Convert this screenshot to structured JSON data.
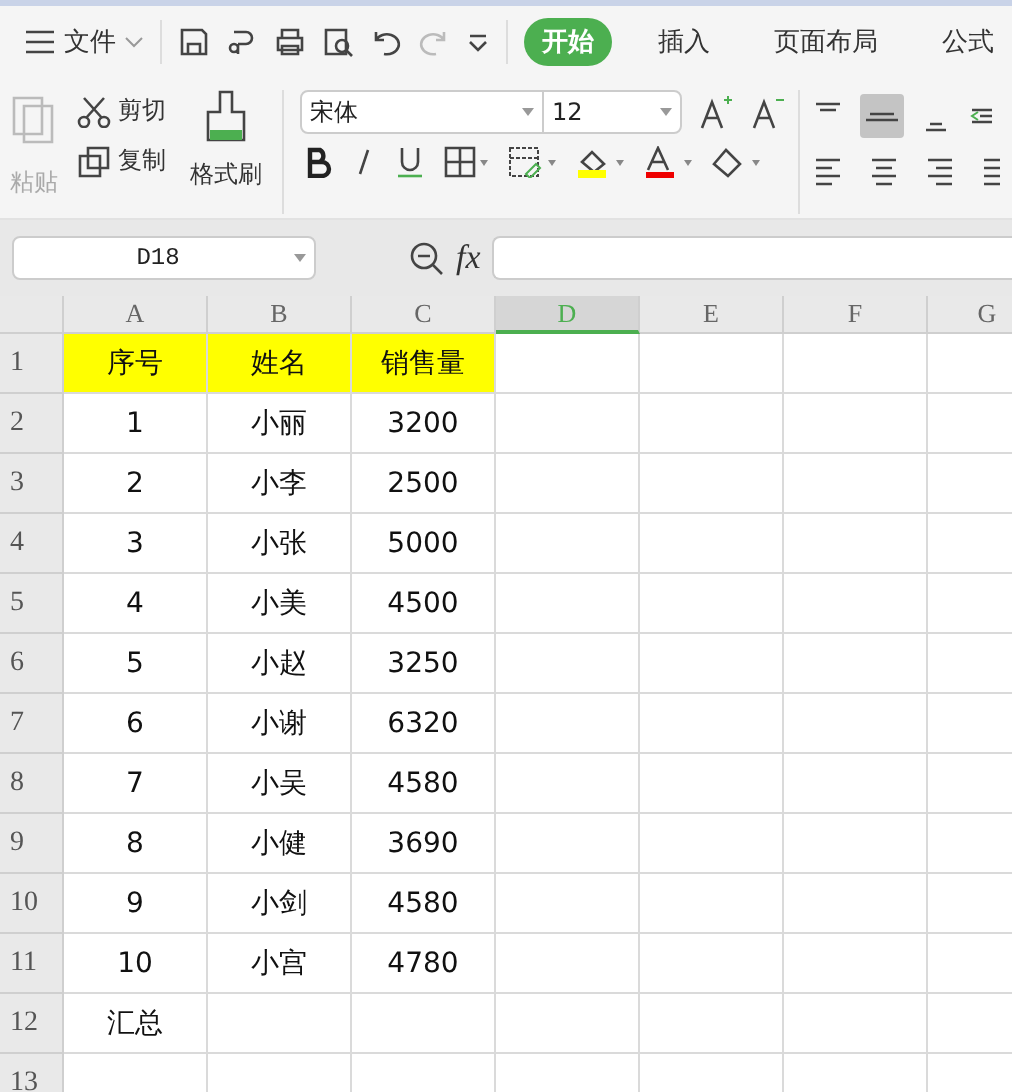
{
  "menu": {
    "file_label": "文件",
    "tabs": [
      {
        "label": "开始",
        "selected": true
      },
      {
        "label": "插入",
        "selected": false
      },
      {
        "label": "页面布局",
        "selected": false
      },
      {
        "label": "公式",
        "selected": false
      }
    ]
  },
  "ribbon": {
    "paste": {
      "label": "粘贴",
      "disabled": true
    },
    "cut": "剪切",
    "copy": "复制",
    "format_painter": "格式刷",
    "font_name": "宋体",
    "font_size": "12"
  },
  "formula_bar": {
    "name_box": "D18",
    "fx": "fx"
  },
  "sheet": {
    "columns": [
      {
        "label": "A",
        "selected": false
      },
      {
        "label": "B",
        "selected": false
      },
      {
        "label": "C",
        "selected": false
      },
      {
        "label": "D",
        "selected": true
      },
      {
        "label": "E",
        "selected": false
      },
      {
        "label": "F",
        "selected": false
      },
      {
        "label": "G",
        "selected": false
      }
    ],
    "rows": [
      {
        "number": "1",
        "highlight": true,
        "cells": [
          "序号",
          "姓名",
          "销售量"
        ]
      },
      {
        "number": "2",
        "highlight": false,
        "cells": [
          "1",
          "小丽",
          "3200"
        ]
      },
      {
        "number": "3",
        "highlight": false,
        "cells": [
          "2",
          "小李",
          "2500"
        ]
      },
      {
        "number": "4",
        "highlight": false,
        "cells": [
          "3",
          "小张",
          "5000"
        ]
      },
      {
        "number": "5",
        "highlight": false,
        "cells": [
          "4",
          "小美",
          "4500"
        ]
      },
      {
        "number": "6",
        "highlight": false,
        "cells": [
          "5",
          "小赵",
          "3250"
        ]
      },
      {
        "number": "7",
        "highlight": false,
        "cells": [
          "6",
          "小谢",
          "6320"
        ]
      },
      {
        "number": "8",
        "highlight": false,
        "cells": [
          "7",
          "小吴",
          "4580"
        ]
      },
      {
        "number": "9",
        "highlight": false,
        "cells": [
          "8",
          "小健",
          "3690"
        ]
      },
      {
        "number": "10",
        "highlight": false,
        "cells": [
          "9",
          "小剑",
          "4580"
        ]
      },
      {
        "number": "11",
        "highlight": false,
        "cells": [
          "10",
          "小宫",
          "4780"
        ]
      },
      {
        "number": "12",
        "highlight": false,
        "cells": [
          "汇总"
        ]
      },
      {
        "number": "13",
        "highlight": false,
        "cells": []
      }
    ]
  }
}
